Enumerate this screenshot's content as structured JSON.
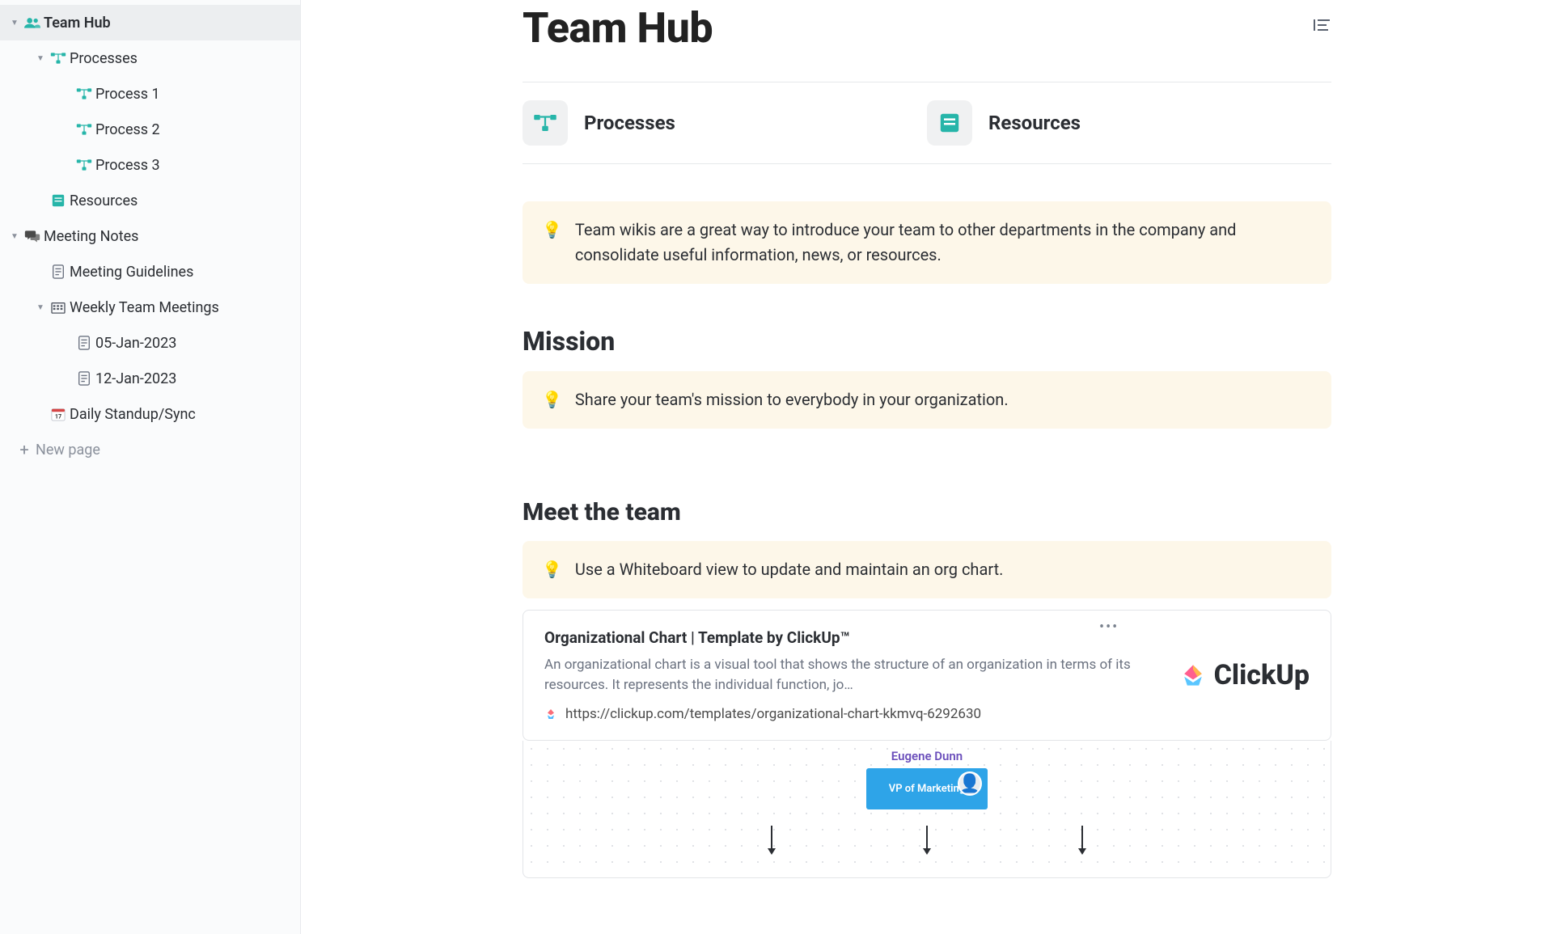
{
  "sidebar": {
    "team_hub": "Team Hub",
    "processes": "Processes",
    "process1": "Process 1",
    "process2": "Process 2",
    "process3": "Process 3",
    "resources": "Resources",
    "meeting_notes": "Meeting Notes",
    "meeting_guidelines": "Meeting Guidelines",
    "weekly_meetings": "Weekly Team Meetings",
    "date1": "05-Jan-2023",
    "date2": "12-Jan-2023",
    "daily_standup": "Daily Standup/Sync",
    "new_page": "New page"
  },
  "page": {
    "title": "Team Hub",
    "cards": {
      "processes": "Processes",
      "resources": "Resources"
    },
    "callout_intro": "Team wikis are a great way to introduce your team to other departments in the company and consolidate useful information, news, or resources.",
    "mission_heading": "Mission",
    "callout_mission": "Share your team's mission to everybody in your organization.",
    "meet_heading": "Meet the team",
    "callout_meet": "Use a Whiteboard view to update and maintain an org chart.",
    "link": {
      "title": "Organizational Chart | Template by ClickUp™",
      "desc": "An organizational chart is a visual tool that shows the structure of an organization in terms of its resources. It represents the individual function, jo…",
      "url": "https://clickup.com/templates/organizational-chart-kkmvq-6292630",
      "brand": "ClickUp"
    },
    "whiteboard": {
      "name": "Eugene Dunn",
      "role": "VP of Marketing"
    }
  }
}
